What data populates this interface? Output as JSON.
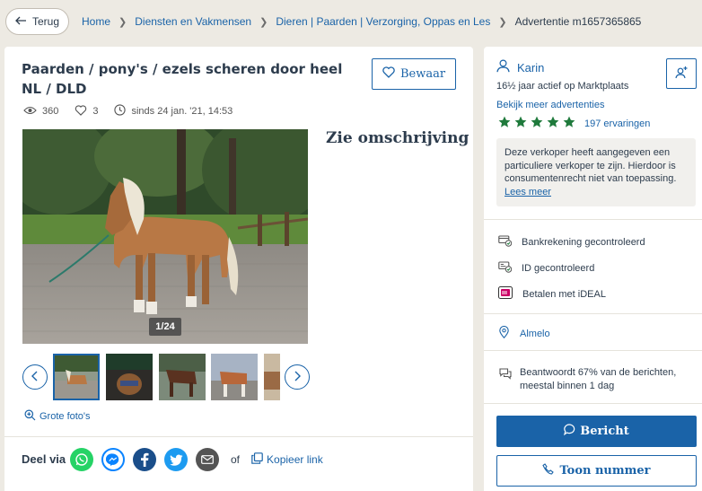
{
  "nav": {
    "back_label": "Terug",
    "breadcrumbs": [
      "Home",
      "Diensten en Vakmensen",
      "Dieren | Paarden | Verzorging, Oppas en Les",
      "Advertentie m1657365865"
    ]
  },
  "listing": {
    "title": "Paarden / pony's / ezels scheren door heel NL / DLD",
    "save_label": "Bewaar",
    "views": "360",
    "favorites": "3",
    "since": "sinds 24 jan. '21, 14:53",
    "photo_counter": "1/24",
    "description_heading": "Zie omschrijving",
    "large_photos_label": "Grote foto's"
  },
  "share": {
    "label": "Deel via",
    "or_label": "of",
    "copy_link_label": "Kopieer link",
    "icons": [
      "whatsapp-icon",
      "messenger-icon",
      "facebook-icon",
      "twitter-icon",
      "email-icon"
    ]
  },
  "seller": {
    "name": "Karin",
    "years_active": "16½ jaar actief op Marktplaats",
    "more_ads_label": "Bekijk meer advertenties",
    "rating_stars": 5,
    "reviews_label": "197 ervaringen",
    "notice_text": "Deze verkoper heeft aangegeven een particuliere verkoper te zijn. Hierdoor is consumentenrecht niet van toepassing.",
    "notice_link": "Lees meer",
    "trust_items": [
      "Bankrekening gecontroleerd",
      "ID gecontroleerd",
      "Betalen met iDEAL"
    ],
    "location": "Almelo",
    "response": "Beantwoordt 67% van de berichten, meestal binnen 1 dag",
    "message_label": "Bericht",
    "phone_label": "Toon nummer"
  },
  "colors": {
    "accent": "#1a63a8",
    "star": "#1f7a3c",
    "background": "#edeae3"
  }
}
